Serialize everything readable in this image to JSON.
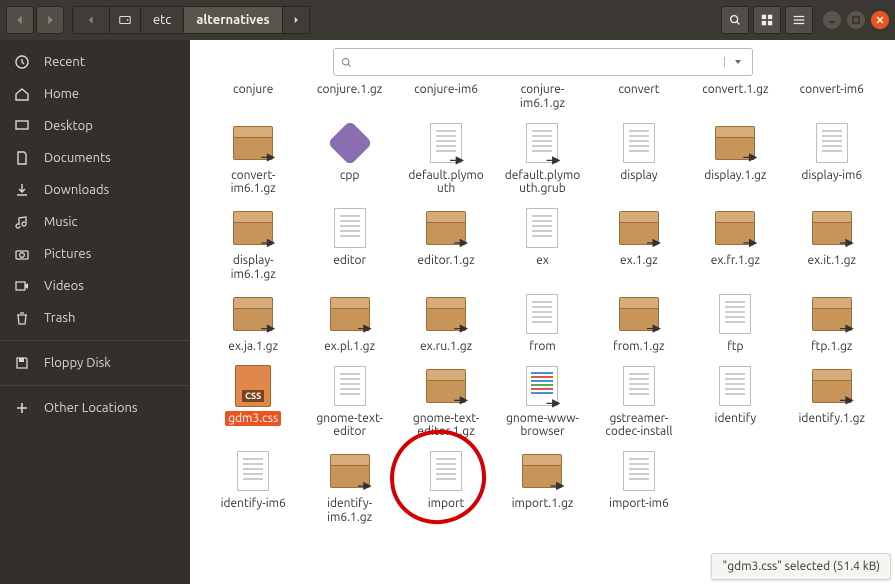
{
  "path": {
    "root_icon": "drive",
    "segment1": "etc",
    "segment2": "alternatives"
  },
  "sidebar": {
    "recent": "Recent",
    "home": "Home",
    "desktop": "Desktop",
    "documents": "Documents",
    "downloads": "Downloads",
    "music": "Music",
    "pictures": "Pictures",
    "videos": "Videos",
    "trash": "Trash",
    "floppy": "Floppy Disk",
    "other": "Other Locations"
  },
  "search": {
    "placeholder": ""
  },
  "files": [
    {
      "kind": "label",
      "label": "conjure"
    },
    {
      "kind": "label",
      "label": "conjure.1.gz"
    },
    {
      "kind": "label",
      "label": "conjure-im6"
    },
    {
      "kind": "label",
      "label": "conjure-im6.1.gz"
    },
    {
      "kind": "label",
      "label": "convert"
    },
    {
      "kind": "label",
      "label": "convert.1.gz"
    },
    {
      "kind": "label",
      "label": "convert-im6"
    },
    {
      "kind": "pkg",
      "label": "convert-im6.1.gz"
    },
    {
      "kind": "cpp",
      "label": "cpp"
    },
    {
      "kind": "doclnk",
      "label": "default.plymouth"
    },
    {
      "kind": "doclnk",
      "label": "default.plymouth.grub"
    },
    {
      "kind": "doc",
      "label": "display"
    },
    {
      "kind": "pkg",
      "label": "display.1.gz"
    },
    {
      "kind": "doc",
      "label": "display-im6"
    },
    {
      "kind": "pkg",
      "label": "display-im6.1.gz"
    },
    {
      "kind": "doc",
      "label": "editor"
    },
    {
      "kind": "pkg",
      "label": "editor.1.gz"
    },
    {
      "kind": "doc",
      "label": "ex"
    },
    {
      "kind": "pkg",
      "label": "ex.1.gz"
    },
    {
      "kind": "pkg",
      "label": "ex.fr.1.gz"
    },
    {
      "kind": "pkg",
      "label": "ex.it.1.gz"
    },
    {
      "kind": "pkg",
      "label": "ex.ja.1.gz"
    },
    {
      "kind": "pkg",
      "label": "ex.pl.1.gz"
    },
    {
      "kind": "pkg",
      "label": "ex.ru.1.gz"
    },
    {
      "kind": "doc",
      "label": "from"
    },
    {
      "kind": "pkg",
      "label": "from.1.gz"
    },
    {
      "kind": "doc",
      "label": "ftp"
    },
    {
      "kind": "pkg",
      "label": "ftp.1.gz"
    },
    {
      "kind": "css",
      "label": "gdm3.css",
      "selected": true
    },
    {
      "kind": "doc",
      "label": "gnome-text-editor"
    },
    {
      "kind": "pkg",
      "label": "gnome-text-editor.1.gz"
    },
    {
      "kind": "html",
      "label": "gnome-www-browser"
    },
    {
      "kind": "doc",
      "label": "gstreamer-codec-install"
    },
    {
      "kind": "doc",
      "label": "identify"
    },
    {
      "kind": "pkg",
      "label": "identify.1.gz"
    },
    {
      "kind": "doc",
      "label": "identify-im6"
    },
    {
      "kind": "pkg",
      "label": "identify-im6.1.gz"
    },
    {
      "kind": "doc",
      "label": "import"
    },
    {
      "kind": "pkg",
      "label": "import.1.gz"
    },
    {
      "kind": "doc",
      "label": "import-im6"
    }
  ],
  "status": {
    "file": "gdm3.css",
    "size": "51.4 kB",
    "text": "\"gdm3.css\" selected  (51.4 kB)"
  },
  "icon_labels": {
    "css": "CSS"
  }
}
